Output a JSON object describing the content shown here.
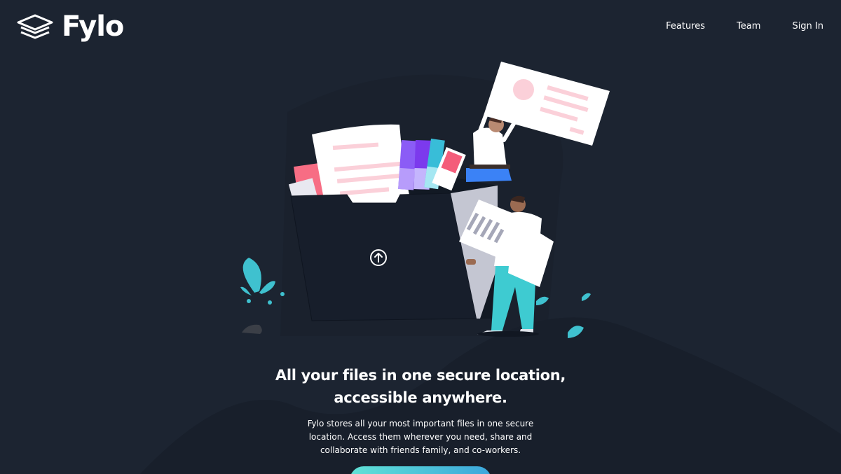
{
  "brand": {
    "name": "Fylo",
    "logo_icon": "stacked-layers-icon"
  },
  "nav": {
    "items": [
      {
        "label": "Features"
      },
      {
        "label": "Team"
      },
      {
        "label": "Sign In"
      }
    ]
  },
  "hero": {
    "title": "All your files in one secure location, accessible anywhere.",
    "description": "Fylo stores all your most important files in one secure location. Access them wherever you need, share and collaborate with friends family, and co-workers.",
    "cta_label": "",
    "upload_icon": "upload-arrow-icon"
  },
  "colors": {
    "background": "#1c2431",
    "background_shape": "#181f2b",
    "accent_teal": "#62e0d9",
    "accent_blue": "#3ca7dc",
    "paper_pink": "#fa8ca0"
  }
}
